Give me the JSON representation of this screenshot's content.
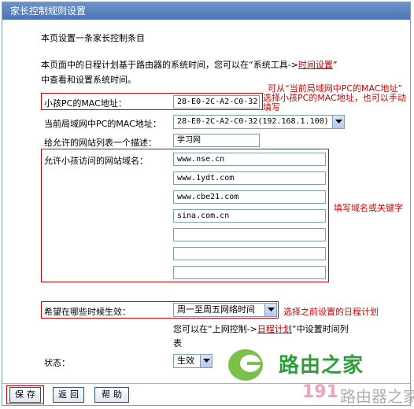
{
  "window": {
    "title": "家长控制规则设置"
  },
  "intro": {
    "heading": "本页设置一条家长控制条目",
    "line1_prefix": "本页面中的日程计划基于路由器的系统时间，您可以在",
    "line1_quote_open": "“系统工具->",
    "line1_link": "时间设置",
    "line1_quote_close": "”",
    "line2": "中查看和设置系统时间。"
  },
  "annotations": {
    "mac_note_1": "可从“当前局域网中PC的MAC地址”",
    "mac_note_2": "选择小孩PC的MAC地址，也可以手动",
    "mac_note_3": "填写",
    "domain_note": "填写域名或关键字",
    "schedule_note": "选择之前设置的日程计划"
  },
  "form": {
    "child_mac_label": "小孩PC的MAC地址：",
    "child_mac_value": "28-E0-2C-A2-C0-32",
    "lan_mac_label": "当前局域网中PC的MAC地址：",
    "lan_mac_selected": "28-E0-2C-A2-C0-32(192.168.1.100)",
    "desc_label": "给允许的网站列表一个描述：",
    "desc_value": "学习网",
    "domains_label": "允许小孩访问的网站域名：",
    "domains": [
      "www.nse.cn",
      "www.1ydt.com",
      "www.cbe21.com",
      "sina.com.cn",
      "",
      "",
      "",
      ""
    ],
    "schedule_label": "希望在哪些时候生效：",
    "schedule_selected": "周一至周五网络时间",
    "schedule_hint_prefix": "您可以在",
    "schedule_hint_quote_open": "“上网控制->",
    "schedule_hint_link": "日程计划",
    "schedule_hint_quote_close": "”",
    "schedule_hint_suffix": "中设置时间列",
    "schedule_hint_line2": "表",
    "status_label": "状态：",
    "status_selected": "生效"
  },
  "buttons": {
    "save": "保存",
    "back": "返回",
    "help": "帮助"
  },
  "watermark": {
    "brand": "路由之家",
    "site_number": "191",
    "site_text": "路由器之家"
  },
  "colors": {
    "title_bg": "#4a74b4",
    "annotation": "#d40000",
    "border": "#7f9db9"
  }
}
